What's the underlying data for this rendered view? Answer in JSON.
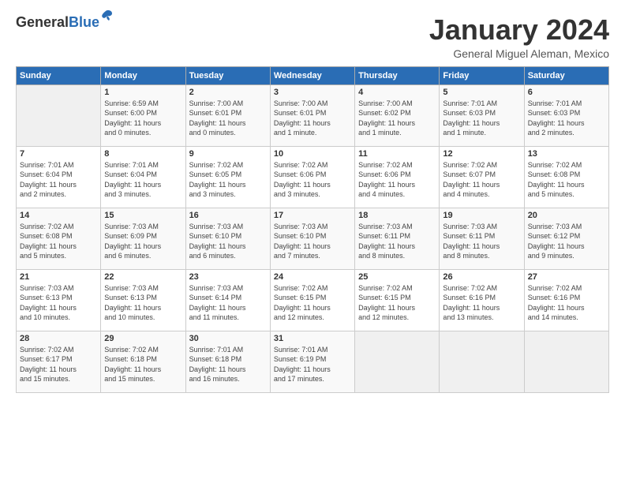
{
  "logo": {
    "general": "General",
    "blue": "Blue"
  },
  "title": "January 2024",
  "location": "General Miguel Aleman, Mexico",
  "days_of_week": [
    "Sunday",
    "Monday",
    "Tuesday",
    "Wednesday",
    "Thursday",
    "Friday",
    "Saturday"
  ],
  "weeks": [
    [
      {
        "num": "",
        "info": ""
      },
      {
        "num": "1",
        "info": "Sunrise: 6:59 AM\nSunset: 6:00 PM\nDaylight: 11 hours\nand 0 minutes."
      },
      {
        "num": "2",
        "info": "Sunrise: 7:00 AM\nSunset: 6:01 PM\nDaylight: 11 hours\nand 0 minutes."
      },
      {
        "num": "3",
        "info": "Sunrise: 7:00 AM\nSunset: 6:01 PM\nDaylight: 11 hours\nand 1 minute."
      },
      {
        "num": "4",
        "info": "Sunrise: 7:00 AM\nSunset: 6:02 PM\nDaylight: 11 hours\nand 1 minute."
      },
      {
        "num": "5",
        "info": "Sunrise: 7:01 AM\nSunset: 6:03 PM\nDaylight: 11 hours\nand 1 minute."
      },
      {
        "num": "6",
        "info": "Sunrise: 7:01 AM\nSunset: 6:03 PM\nDaylight: 11 hours\nand 2 minutes."
      }
    ],
    [
      {
        "num": "7",
        "info": "Sunrise: 7:01 AM\nSunset: 6:04 PM\nDaylight: 11 hours\nand 2 minutes."
      },
      {
        "num": "8",
        "info": "Sunrise: 7:01 AM\nSunset: 6:04 PM\nDaylight: 11 hours\nand 3 minutes."
      },
      {
        "num": "9",
        "info": "Sunrise: 7:02 AM\nSunset: 6:05 PM\nDaylight: 11 hours\nand 3 minutes."
      },
      {
        "num": "10",
        "info": "Sunrise: 7:02 AM\nSunset: 6:06 PM\nDaylight: 11 hours\nand 3 minutes."
      },
      {
        "num": "11",
        "info": "Sunrise: 7:02 AM\nSunset: 6:06 PM\nDaylight: 11 hours\nand 4 minutes."
      },
      {
        "num": "12",
        "info": "Sunrise: 7:02 AM\nSunset: 6:07 PM\nDaylight: 11 hours\nand 4 minutes."
      },
      {
        "num": "13",
        "info": "Sunrise: 7:02 AM\nSunset: 6:08 PM\nDaylight: 11 hours\nand 5 minutes."
      }
    ],
    [
      {
        "num": "14",
        "info": "Sunrise: 7:02 AM\nSunset: 6:08 PM\nDaylight: 11 hours\nand 5 minutes."
      },
      {
        "num": "15",
        "info": "Sunrise: 7:03 AM\nSunset: 6:09 PM\nDaylight: 11 hours\nand 6 minutes."
      },
      {
        "num": "16",
        "info": "Sunrise: 7:03 AM\nSunset: 6:10 PM\nDaylight: 11 hours\nand 6 minutes."
      },
      {
        "num": "17",
        "info": "Sunrise: 7:03 AM\nSunset: 6:10 PM\nDaylight: 11 hours\nand 7 minutes."
      },
      {
        "num": "18",
        "info": "Sunrise: 7:03 AM\nSunset: 6:11 PM\nDaylight: 11 hours\nand 8 minutes."
      },
      {
        "num": "19",
        "info": "Sunrise: 7:03 AM\nSunset: 6:11 PM\nDaylight: 11 hours\nand 8 minutes."
      },
      {
        "num": "20",
        "info": "Sunrise: 7:03 AM\nSunset: 6:12 PM\nDaylight: 11 hours\nand 9 minutes."
      }
    ],
    [
      {
        "num": "21",
        "info": "Sunrise: 7:03 AM\nSunset: 6:13 PM\nDaylight: 11 hours\nand 10 minutes."
      },
      {
        "num": "22",
        "info": "Sunrise: 7:03 AM\nSunset: 6:13 PM\nDaylight: 11 hours\nand 10 minutes."
      },
      {
        "num": "23",
        "info": "Sunrise: 7:03 AM\nSunset: 6:14 PM\nDaylight: 11 hours\nand 11 minutes."
      },
      {
        "num": "24",
        "info": "Sunrise: 7:02 AM\nSunset: 6:15 PM\nDaylight: 11 hours\nand 12 minutes."
      },
      {
        "num": "25",
        "info": "Sunrise: 7:02 AM\nSunset: 6:15 PM\nDaylight: 11 hours\nand 12 minutes."
      },
      {
        "num": "26",
        "info": "Sunrise: 7:02 AM\nSunset: 6:16 PM\nDaylight: 11 hours\nand 13 minutes."
      },
      {
        "num": "27",
        "info": "Sunrise: 7:02 AM\nSunset: 6:16 PM\nDaylight: 11 hours\nand 14 minutes."
      }
    ],
    [
      {
        "num": "28",
        "info": "Sunrise: 7:02 AM\nSunset: 6:17 PM\nDaylight: 11 hours\nand 15 minutes."
      },
      {
        "num": "29",
        "info": "Sunrise: 7:02 AM\nSunset: 6:18 PM\nDaylight: 11 hours\nand 15 minutes."
      },
      {
        "num": "30",
        "info": "Sunrise: 7:01 AM\nSunset: 6:18 PM\nDaylight: 11 hours\nand 16 minutes."
      },
      {
        "num": "31",
        "info": "Sunrise: 7:01 AM\nSunset: 6:19 PM\nDaylight: 11 hours\nand 17 minutes."
      },
      {
        "num": "",
        "info": ""
      },
      {
        "num": "",
        "info": ""
      },
      {
        "num": "",
        "info": ""
      }
    ]
  ]
}
